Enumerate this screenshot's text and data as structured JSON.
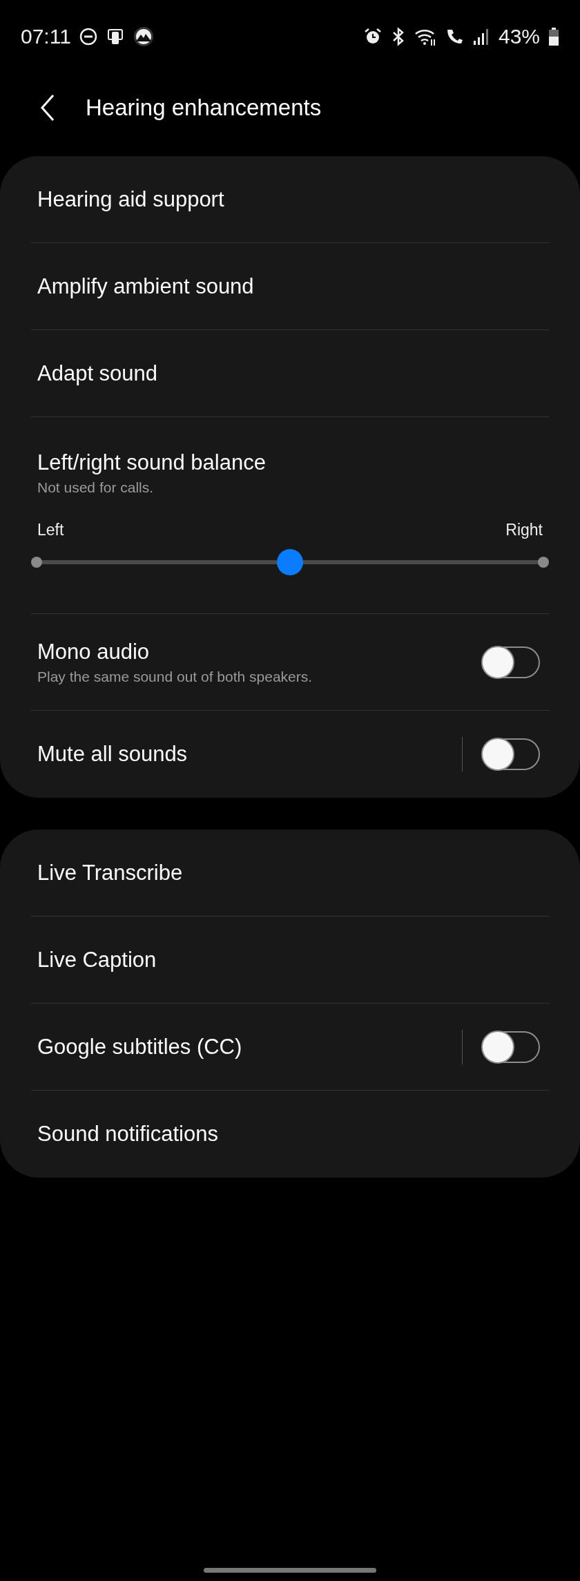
{
  "status_bar": {
    "time": "07:11",
    "battery": "43%"
  },
  "header": {
    "title": "Hearing enhancements"
  },
  "sections": [
    {
      "items": [
        {
          "kind": "link",
          "title": "Hearing aid support"
        },
        {
          "kind": "link",
          "title": "Amplify ambient sound"
        },
        {
          "kind": "link",
          "title": "Adapt sound"
        },
        {
          "kind": "slider",
          "title": "Left/right sound balance",
          "subtitle": "Not used for calls.",
          "left_label": "Left",
          "right_label": "Right",
          "level": 0.5
        },
        {
          "kind": "switch",
          "title": "Mono audio",
          "subtitle": "Play the same sound out of both speakers.",
          "on": false
        },
        {
          "kind": "split_switch",
          "title": "Mute all sounds",
          "on": false
        }
      ]
    },
    {
      "items": [
        {
          "kind": "link",
          "title": "Live Transcribe"
        },
        {
          "kind": "link",
          "title": "Live Caption"
        },
        {
          "kind": "split_switch",
          "title": "Google subtitles (CC)",
          "on": false
        },
        {
          "kind": "link",
          "title": "Sound notifications"
        }
      ]
    }
  ]
}
